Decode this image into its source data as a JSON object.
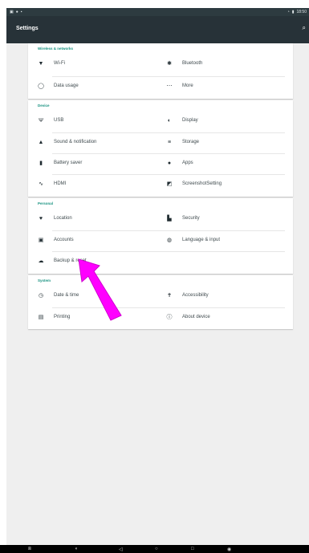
{
  "status_bar": {
    "left_icons": [
      "photo-icon",
      "alert-icon",
      "notification-icon"
    ],
    "right_icons": [
      "wifi-icon",
      "battery-icon"
    ],
    "time": "18:50"
  },
  "action_bar": {
    "title": "Settings",
    "search_icon": "search-icon"
  },
  "sections": [
    {
      "header": "Wireless & networks",
      "items": [
        {
          "label": "Wi-Fi",
          "icon": "wifi-icon"
        },
        {
          "label": "Bluetooth",
          "icon": "bluetooth-icon"
        },
        {
          "label": "Data usage",
          "icon": "data-usage-icon"
        },
        {
          "label": "More",
          "icon": "more-icon"
        }
      ]
    },
    {
      "header": "Device",
      "items": [
        {
          "label": "USB",
          "icon": "usb-icon"
        },
        {
          "label": "Display",
          "icon": "display-icon"
        },
        {
          "label": "Sound & notification",
          "icon": "bell-icon"
        },
        {
          "label": "Storage",
          "icon": "storage-icon"
        },
        {
          "label": "Battery saver",
          "icon": "battery-icon"
        },
        {
          "label": "Apps",
          "icon": "android-icon"
        },
        {
          "label": "HDMI",
          "icon": "hdmi-icon"
        },
        {
          "label": "ScreenshotSetting",
          "icon": "screenshot-icon"
        }
      ]
    },
    {
      "header": "Personal",
      "items": [
        {
          "label": "Location",
          "icon": "location-pin-icon"
        },
        {
          "label": "Security",
          "icon": "lock-icon"
        },
        {
          "label": "Accounts",
          "icon": "account-icon"
        },
        {
          "label": "Language & input",
          "icon": "globe-icon"
        },
        {
          "label": "Backup & reset",
          "icon": "cloud-upload-icon"
        }
      ]
    },
    {
      "header": "System",
      "items": [
        {
          "label": "Date & time",
          "icon": "clock-icon"
        },
        {
          "label": "Accessibility",
          "icon": "accessibility-icon"
        },
        {
          "label": "Printing",
          "icon": "printer-icon"
        },
        {
          "label": "About device",
          "icon": "info-icon"
        }
      ]
    }
  ],
  "nav_bar": {
    "icons": [
      "screenshot-icon",
      "volume-down-icon",
      "back-icon",
      "home-icon",
      "recents-icon",
      "volume-up-icon"
    ]
  },
  "overlay": {
    "icon": "magenta-arrow-icon",
    "color": "#ff00ff"
  },
  "colors": {
    "accent": "#16917f",
    "actionbar": "#273238",
    "statusbar": "#2d3b40"
  }
}
